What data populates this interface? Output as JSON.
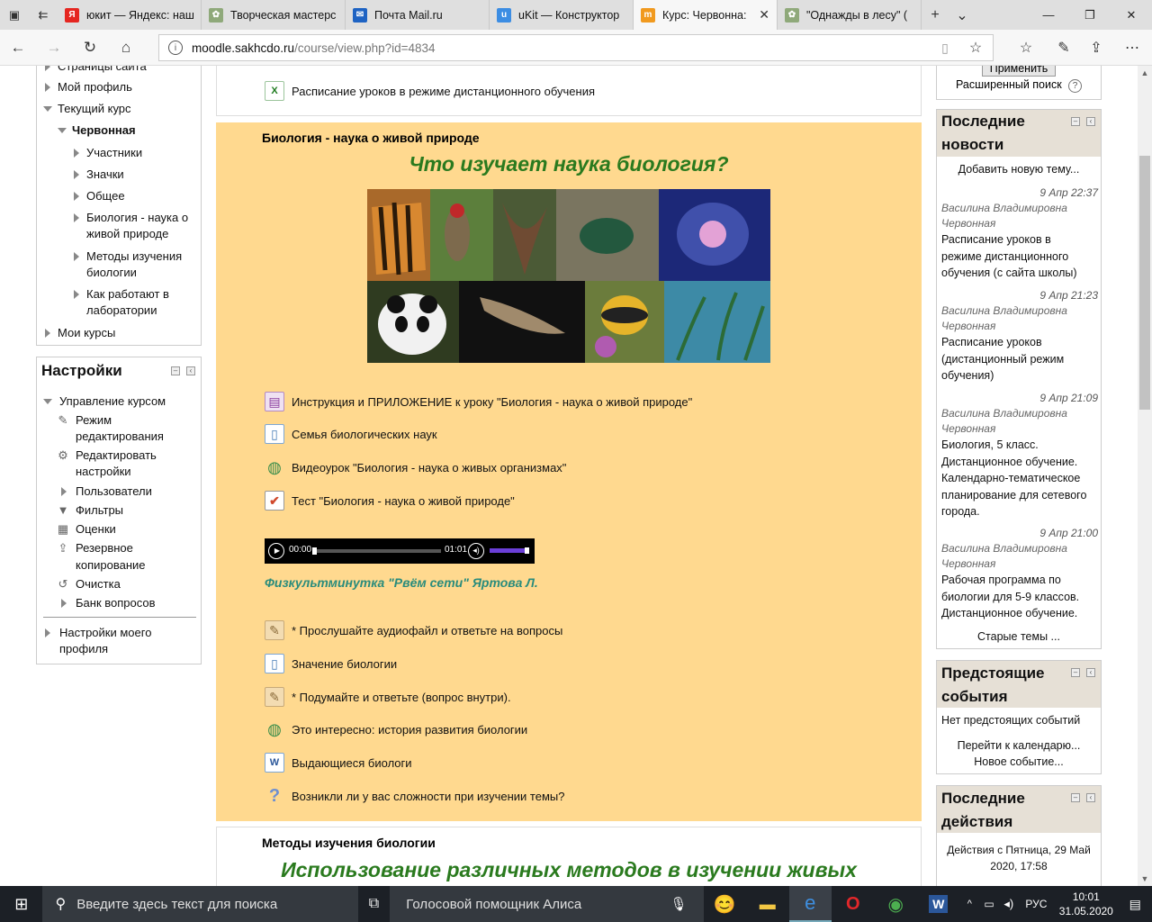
{
  "tabs": [
    {
      "label": "юкит — Яндекс: наш",
      "fav": "Я",
      "color": "#e52620"
    },
    {
      "label": "Творческая мастерс",
      "fav": "✿",
      "color": "#8fa97a"
    },
    {
      "label": "Почта Mail.ru",
      "fav": "✉",
      "color": "#1e63c3"
    },
    {
      "label": "uKit — Конструктор",
      "fav": "u",
      "color": "#3c8de3"
    },
    {
      "label": "Курс: Червонна:",
      "fav": "m",
      "color": "#f19a1f"
    },
    {
      "label": "\"Однажды в лесу\" (",
      "fav": "✿",
      "color": "#8fa97a"
    }
  ],
  "address": {
    "host": "moodle.sakhcdo.ru",
    "path": "/course/view.php?id=4834"
  },
  "left_nav": {
    "items": [
      {
        "label": "Страницы сайта"
      },
      {
        "label": "Мой профиль"
      },
      {
        "label": "Текущий курс"
      },
      {
        "label": "Червонная"
      },
      {
        "label": "Участники"
      },
      {
        "label": "Значки"
      },
      {
        "label": "Общее"
      },
      {
        "label": "Биология - наука о"
      },
      {
        "label": "живой природе"
      },
      {
        "label": "Методы изучения"
      },
      {
        "label": "биологии"
      },
      {
        "label": "Как работают в"
      },
      {
        "label": "лаборатории"
      },
      {
        "label": "Мои курсы"
      }
    ]
  },
  "settings": {
    "title": "Настройки",
    "items": [
      {
        "label": "Управление курсом"
      },
      {
        "label": "Режим"
      },
      {
        "label": "редактирования"
      },
      {
        "label": "Редактировать"
      },
      {
        "label": "настройки"
      },
      {
        "label": "Пользователи"
      },
      {
        "label": "Фильтры"
      },
      {
        "label": "Оценки"
      },
      {
        "label": "Резервное"
      },
      {
        "label": "копирование"
      },
      {
        "label": "Очистка"
      },
      {
        "label": "Банк вопросов"
      },
      {
        "label": "Настройки моего"
      },
      {
        "label": "профиля"
      }
    ]
  },
  "center": {
    "top_activity": "Расписание уроков в режиме дистанционного обучения",
    "section1_title": "Биология - наука о живой природе",
    "section1_heading": "Что изучает наука биология?",
    "activities1": [
      {
        "label": "Инструкция и ПРИЛОЖЕНИЕ к уроку \"Биология - наука о живой природе\"",
        "icon": "book-icon"
      },
      {
        "label": "Семья биологических наук",
        "icon": "page-icon"
      },
      {
        "label": "Видеоурок \"Биология - наука о живых организмах\"",
        "icon": "url-icon"
      },
      {
        "label": "Тест \"Биология - наука о живой природе\"",
        "icon": "quiz-icon"
      }
    ],
    "audio": {
      "current": "00:00",
      "duration": "01:01"
    },
    "fizkult": "Физкультминутка \"Рвём сети\" Яртова Л.",
    "activities2": [
      {
        "label": "* Прослушайте аудиофайл и ответьте на вопросы",
        "icon": "assign-icon"
      },
      {
        "label": "Значение биологии",
        "icon": "page-icon"
      },
      {
        "label": "* Подумайте и ответьте (вопрос внутри).",
        "icon": "assign-icon"
      },
      {
        "label": "Это интересно: история развития биологии",
        "icon": "url-icon"
      },
      {
        "label": "Выдающиеся биологи",
        "icon": "word-icon"
      },
      {
        "label": "Возникли ли у вас сложности при изучении темы?",
        "icon": "feedback-icon"
      }
    ],
    "section2_title": "Методы изучения биологии",
    "section2_heading": "Использование различных методов в изучении живых"
  },
  "right": {
    "apply": "Применить",
    "advanced": "Расширенный поиск",
    "news_title_1": "Последние",
    "news_title_2": "новости",
    "add_topic": "Добавить новую тему...",
    "news": [
      {
        "date": "9 Апр 22:37",
        "author1": "Василина Владимировна",
        "author2": "Червонная",
        "lines": [
          "Расписание уроков в",
          "режиме дистанционного",
          "обучения (с сайта школы)"
        ]
      },
      {
        "date": "9 Апр 21:23",
        "author1": "Василина Владимировна",
        "author2": "Червонная",
        "lines": [
          "Расписание уроков",
          "(дистанционный режим",
          "обучения)"
        ]
      },
      {
        "date": "9 Апр 21:09",
        "author1": "Василина Владимировна",
        "author2": "Червонная",
        "lines": [
          "Биология, 5 класс.",
          "Дистанционное обучение.",
          "Календарно-тематическое",
          "планирование для сетевого",
          "города."
        ]
      },
      {
        "date": "9 Апр 21:00",
        "author1": "Василина Владимировна",
        "author2": "Червонная",
        "lines": [
          "Рабочая программа по",
          "биологии для 5-9 классов.",
          "Дистанционное обучение."
        ]
      }
    ],
    "old_topics": "Старые темы ...",
    "events_title_1": "Предстоящие",
    "events_title_2": "события",
    "no_events": "Нет предстоящих событий",
    "goto_calendar": "Перейти к календарю...",
    "new_event": "Новое событие...",
    "recent_title_1": "Последние",
    "recent_title_2": "действия",
    "recent_since_1": "Действия с Пятница, 29 Май",
    "recent_since_2": "2020, 17:58"
  },
  "taskbar": {
    "search_placeholder": "Введите здесь текст для поиска",
    "alice": "Голосовой помощник Алиса",
    "lang": "РУС",
    "time": "10:01",
    "date": "31.05.2020"
  }
}
